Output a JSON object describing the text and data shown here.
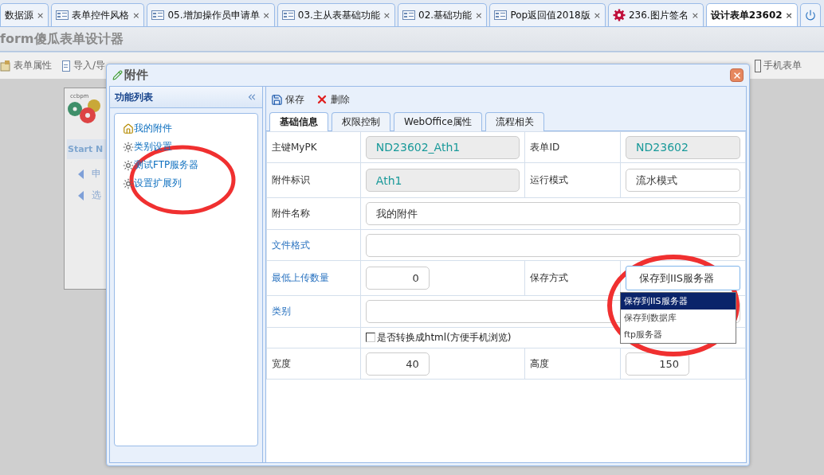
{
  "tabs": [
    {
      "label": "数据源",
      "kind": "plain",
      "close": "×",
      "selected": false
    },
    {
      "label": "表单控件风格",
      "kind": "form",
      "close": "×",
      "selected": false
    },
    {
      "label": "05.增加操作员申请单",
      "kind": "form",
      "close": "×",
      "selected": false
    },
    {
      "label": "03.主从表基础功能",
      "kind": "form",
      "close": "×",
      "selected": false
    },
    {
      "label": "02.基础功能",
      "kind": "form",
      "close": "×",
      "selected": false
    },
    {
      "label": "Pop返回值2018版",
      "kind": "form",
      "close": "×",
      "selected": false
    },
    {
      "label": "236.图片签名",
      "kind": "image",
      "close": "×",
      "selected": false
    },
    {
      "label": "设计表单23602",
      "kind": "plain",
      "close": "×",
      "selected": true
    }
  ],
  "app_title": "form傻瓜表单设计器",
  "toolbar": [
    {
      "label": "表单属性"
    },
    {
      "label": "导入/导"
    },
    {
      "label": "手机表单"
    }
  ],
  "background_card": {
    "logo_text": "ccbpm",
    "heading": "Start N",
    "rows": [
      "申",
      "选"
    ]
  },
  "dialog": {
    "title": "附件",
    "sidebar": {
      "title": "功能列表",
      "items": [
        {
          "label": "我的附件",
          "kind": "root"
        },
        {
          "label": "类别设置",
          "kind": "leaf"
        },
        {
          "label": "测试FTP服务器",
          "kind": "leaf"
        },
        {
          "label": "设置扩展列",
          "kind": "leaf"
        }
      ]
    },
    "actions": [
      {
        "label": "保存"
      },
      {
        "label": "删除"
      }
    ],
    "tabs": [
      {
        "label": "基础信息",
        "selected": true
      },
      {
        "label": "权限控制",
        "selected": false
      },
      {
        "label": "WebOffice属性",
        "selected": false
      },
      {
        "label": "流程相关",
        "selected": false
      }
    ],
    "rows": [
      {
        "kind": "pair",
        "fields": [
          {
            "label": "主键MyPK",
            "accent": false,
            "kind": "readonly",
            "value": "ND23602_Ath1"
          },
          {
            "label": "表单ID",
            "accent": false,
            "kind": "readonly",
            "value": "ND23602"
          }
        ]
      },
      {
        "kind": "pair",
        "fields": [
          {
            "label": "附件标识",
            "accent": false,
            "kind": "readonly",
            "value": "Ath1"
          },
          {
            "label": "运行模式",
            "accent": false,
            "kind": "input",
            "value": "流水模式"
          }
        ]
      },
      {
        "kind": "wide",
        "fields": [
          {
            "label": "附件名称",
            "accent": false,
            "kind": "input",
            "value": "我的附件"
          }
        ]
      },
      {
        "kind": "wide",
        "fields": [
          {
            "label": "文件格式",
            "accent": true,
            "kind": "input"
          }
        ]
      },
      {
        "kind": "pair",
        "fields": [
          {
            "label": "最低上传数量",
            "accent": true,
            "kind": "number",
            "value": "0"
          },
          {
            "label": "保存方式",
            "accent": false,
            "kind": "select",
            "value": "保存到IIS服务器",
            "expanded": true,
            "options": [
              {
                "label": "保存到IIS服务器",
                "selected": true
              },
              {
                "label": "保存到数据库",
                "selected": false
              },
              {
                "label": "ftp服务器",
                "selected": false
              }
            ]
          }
        ]
      },
      {
        "kind": "wide",
        "fields": [
          {
            "label": "类别",
            "accent": true,
            "kind": "input"
          }
        ]
      },
      {
        "kind": "checkbox",
        "label": "是否转换成html(方便手机浏览)",
        "checked": false
      },
      {
        "kind": "pair",
        "fields": [
          {
            "label": "宽度",
            "accent": false,
            "kind": "number",
            "value": "40"
          },
          {
            "label": "高度",
            "accent": false,
            "kind": "number",
            "value": "150"
          }
        ]
      }
    ]
  }
}
